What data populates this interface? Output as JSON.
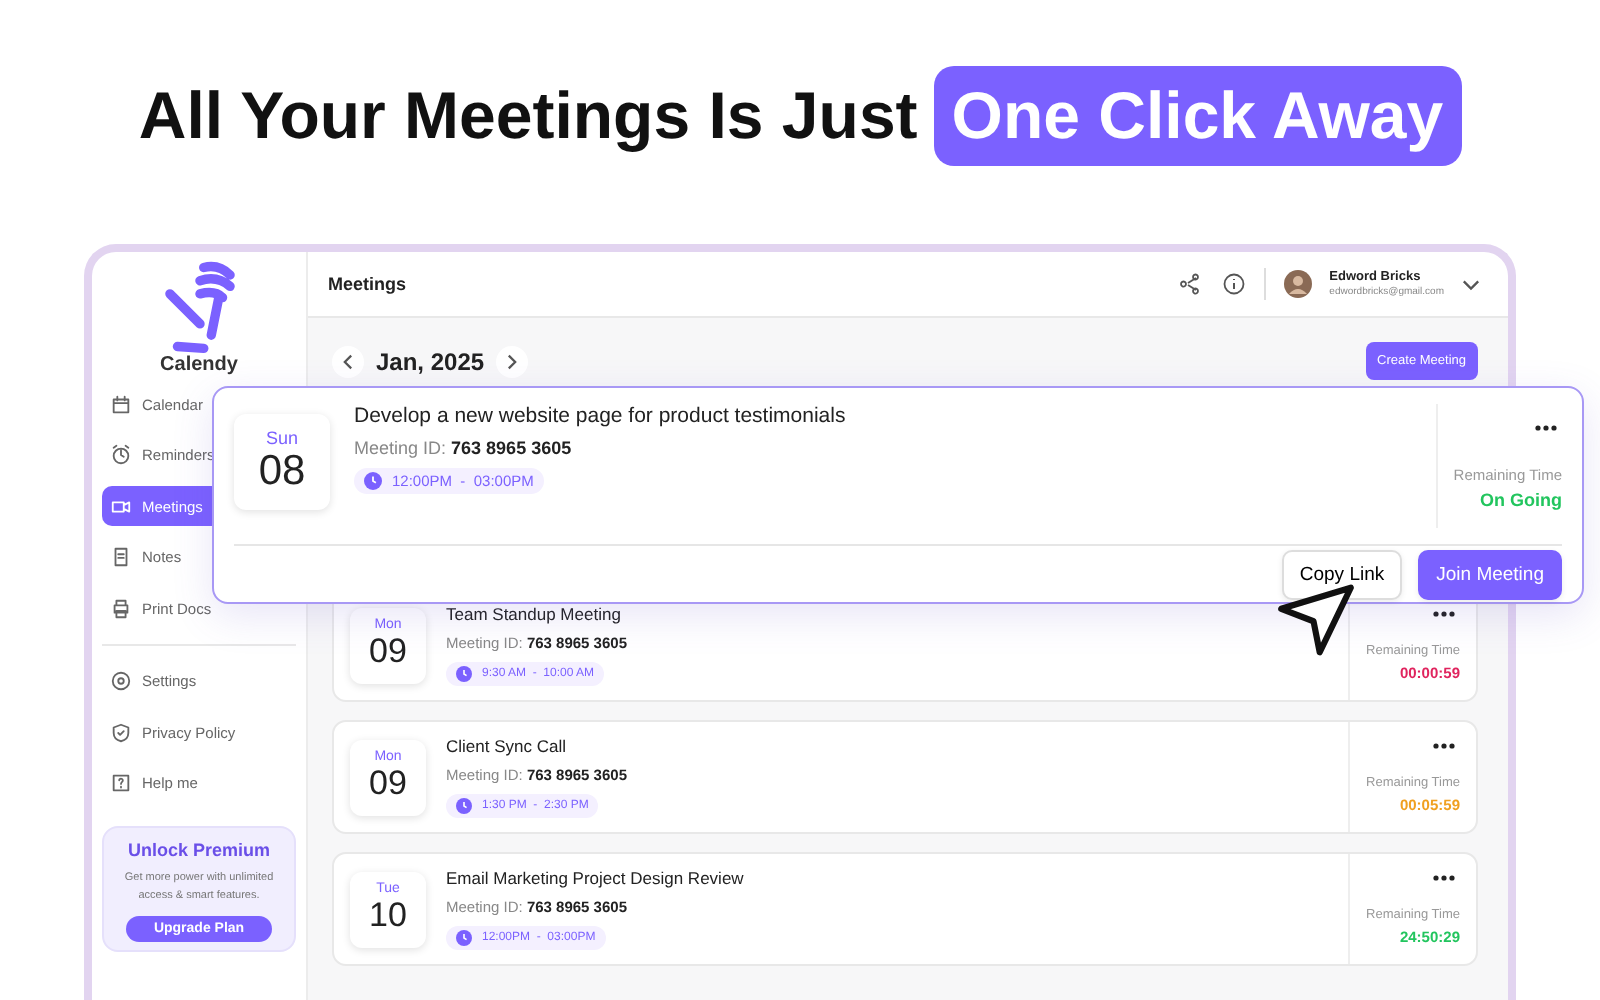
{
  "headline": {
    "text": "All Your Meetings Is Just",
    "highlight": "One Click Away"
  },
  "sidebar": {
    "logo": "Calendy",
    "items": [
      {
        "label": "Calendar",
        "selected": false
      },
      {
        "label": "Reminders",
        "selected": false
      },
      {
        "label": "Meetings",
        "selected": true
      },
      {
        "label": "Notes",
        "selected": false
      },
      {
        "label": "Print Docs",
        "selected": false
      }
    ],
    "settings": [
      {
        "label": "Settings",
        "selected": false
      },
      {
        "label": "Privacy Policy",
        "selected": false
      },
      {
        "label": "Help me",
        "selected": false
      }
    ],
    "premium": {
      "title": "Unlock Premium",
      "text": "Get more power with unlimited access & smart features.",
      "button": "Upgrade Plan"
    }
  },
  "header": {
    "title": "Meetings",
    "user": {
      "name": "Edword Bricks",
      "email": "edwordbricks@gmail.com"
    }
  },
  "month": "Jan, 2025",
  "create_button": "Create Meeting",
  "featured": {
    "day": "Sun",
    "date": "08",
    "title": "Develop a new website page for product testimonials",
    "id_label": "Meeting ID:",
    "meeting_id": "763 8965 3605",
    "time": "12:00PM  -  03:00PM",
    "remaining_label": "Remaining Time",
    "remaining": "On Going",
    "color": "#22c55e",
    "buttons": [
      "Copy Link",
      "Join Meeting"
    ]
  },
  "meetings": [
    {
      "day": "Mon",
      "date": "09",
      "title": "Team Standup Meeting",
      "id_label": "Meeting ID:",
      "meeting_id": "763 8965 3605",
      "time": "9:30 AM  -  10:00 AM",
      "remaining_label": "Remaining Time",
      "remaining": "00:00:59",
      "color": "#e0245e"
    },
    {
      "day": "Mon",
      "date": "09",
      "title": "Client Sync Call",
      "id_label": "Meeting ID:",
      "meeting_id": "763 8965 3605",
      "time": "1:30 PM  -  2:30 PM",
      "remaining_label": "Remaining Time",
      "remaining": "00:05:59",
      "color": "#f0a020"
    },
    {
      "day": "Tue",
      "date": "10",
      "title": "Email Marketing Project Design Review",
      "id_label": "Meeting ID:",
      "meeting_id": "763 8965 3605",
      "time": "12:00PM  -  03:00PM",
      "remaining_label": "Remaining Time",
      "remaining": "24:50:29",
      "color": "#22c55e"
    }
  ]
}
